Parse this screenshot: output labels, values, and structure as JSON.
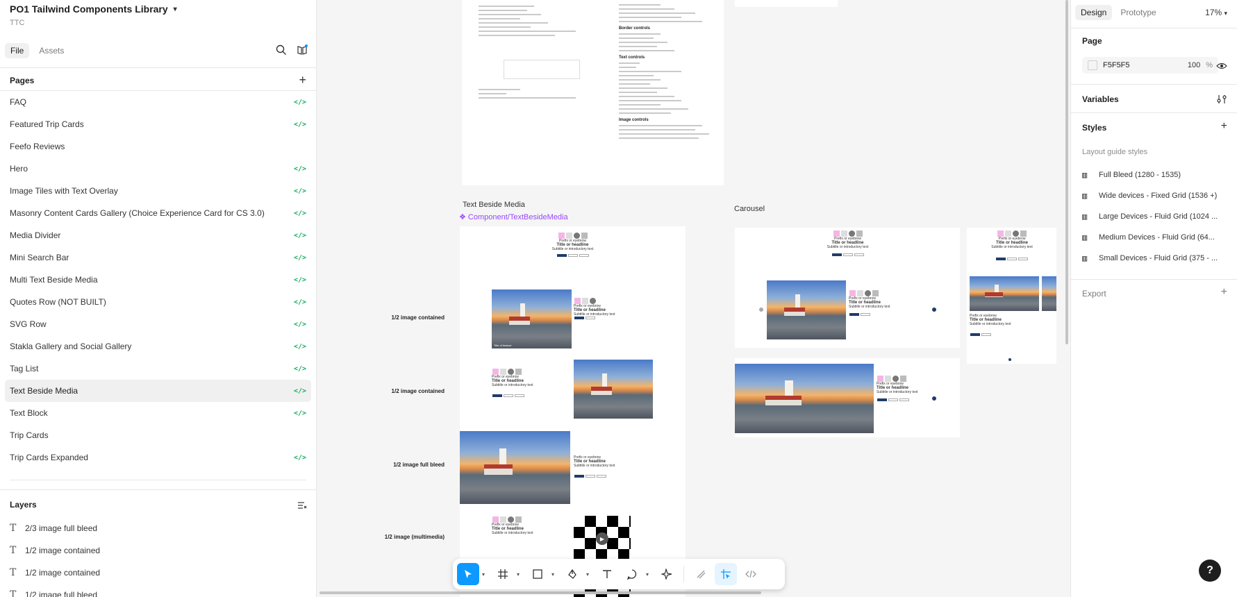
{
  "project": {
    "title": "PO1 Tailwind Components Library",
    "team": "TTC"
  },
  "left_tabs": [
    "File",
    "Assets"
  ],
  "pages_header": "Pages",
  "pages": [
    {
      "label": "FAQ",
      "code": true
    },
    {
      "label": "Featured Trip Cards",
      "code": true
    },
    {
      "label": "Feefo Reviews",
      "code": false
    },
    {
      "label": "Hero",
      "code": true
    },
    {
      "label": "Image Tiles with Text Overlay",
      "code": true
    },
    {
      "label": "Masonry Content Cards Gallery (Choice Experience Card for CS 3.0)",
      "code": true
    },
    {
      "label": "Media Divider",
      "code": true
    },
    {
      "label": "Mini Search Bar",
      "code": true
    },
    {
      "label": "Multi Text Beside Media",
      "code": true
    },
    {
      "label": "Quotes Row (NOT BUILT)",
      "code": true
    },
    {
      "label": "SVG Row",
      "code": true
    },
    {
      "label": "Stakla Gallery and Social Gallery",
      "code": true
    },
    {
      "label": "Tag List",
      "code": true
    },
    {
      "label": "Text Beside Media",
      "code": true,
      "active": true
    },
    {
      "label": "Text Block",
      "code": true
    },
    {
      "label": "Trip Cards",
      "code": false
    },
    {
      "label": "Trip Cards Expanded",
      "code": true
    }
  ],
  "code_badge": "</>",
  "layers_header": "Layers",
  "layers": [
    "2/3 image full bleed",
    "1/2 image contained",
    "1/2 image contained",
    "1/2 image full bleed"
  ],
  "canvas": {
    "frame_text_beside_media": "Text Beside Media",
    "component_name": "Component/TextBesideMedia",
    "frame_carousel": "Carousel",
    "row_labels": [
      "1/2 image contained",
      "1/2 image contained",
      "1/2 image full bleed",
      "1/2 image (multimedia)"
    ],
    "doc_headings": [
      "Border controls",
      "Text controls",
      "Image controls"
    ],
    "mini_eyebrow": "Prefix or eyebrow",
    "mini_title": "Title or headline",
    "mini_subtitle": "Subtitle or introductory text",
    "image_caption": "Title of feature"
  },
  "right_tabs": [
    "Design",
    "Prototype"
  ],
  "zoom": "17%",
  "page_section": {
    "title": "Page",
    "fill_hex": "F5F5F5",
    "fill_opacity": "100",
    "fill_unit": "%"
  },
  "variables_title": "Variables",
  "styles_title": "Styles",
  "layout_guide_title": "Layout guide styles",
  "layout_guides": [
    "Full Bleed (1280 - 1535)",
    "Wide devices - Fixed Grid (1536 +)",
    "Large Devices - Fluid Grid (1024 ...",
    "Medium Devices - Fluid Grid (64...",
    "Small Devices - Fluid Grid (375 - ..."
  ],
  "export_title": "Export",
  "help_label": "?",
  "colors": {
    "accent": "#0D99FF",
    "code_green": "#14AE5C",
    "component_purple": "#9747FF",
    "button_navy": "#1F3C68"
  }
}
